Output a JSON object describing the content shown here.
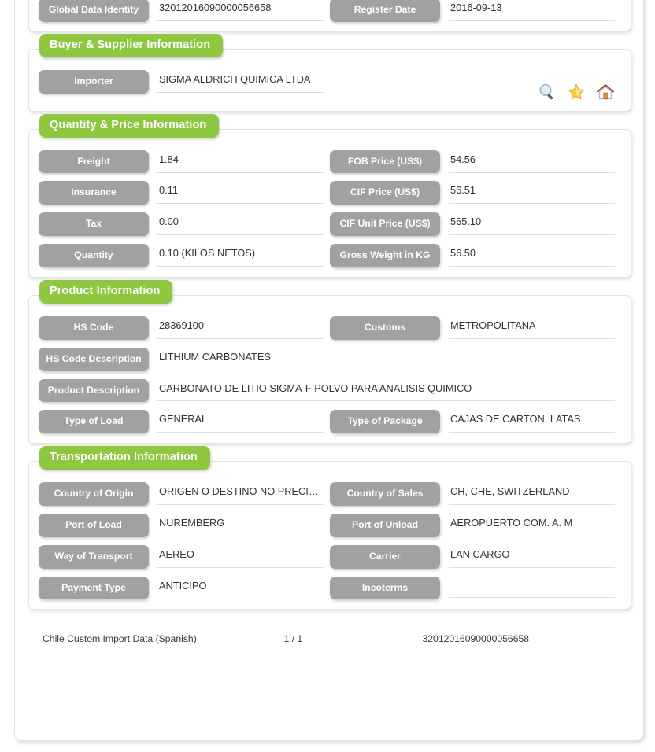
{
  "document": {
    "footer_source": "Chile Custom Import Data (Spanish)",
    "footer_page": "1 / 1",
    "footer_id": "32012016090000056658"
  },
  "colors": {
    "section_green": "#8fc740",
    "label_gray": "#a1a1a1",
    "value_text": "#333333",
    "underline": "#dedede"
  },
  "header_fields": {
    "global_data_identity_label": "Global Data Identity",
    "global_data_identity_value": "32012016090000056658",
    "register_date_label": "Register Date",
    "register_date_value": "2016-09-13"
  },
  "buyer_supplier": {
    "title": "Buyer & Supplier Information",
    "importer_label": "Importer",
    "importer_value": "SIGMA ALDRICH QUIMICA LTDA",
    "icons": [
      {
        "name": "search-icon",
        "title": "Search"
      },
      {
        "name": "star-icon",
        "title": "Favorite"
      },
      {
        "name": "home-icon",
        "title": "Home"
      }
    ]
  },
  "quantity_price": {
    "title": "Quantity & Price Information",
    "rows": [
      {
        "left_label": "Freight",
        "left_value": "1.84",
        "right_label": "FOB Price (US$)",
        "right_value": "54.56"
      },
      {
        "left_label": "Insurance",
        "left_value": "0.11",
        "right_label": "CIF Price (US$)",
        "right_value": "56.51"
      },
      {
        "left_label": "Tax",
        "left_value": "0.00",
        "right_label": "CIF Unit Price (US$)",
        "right_value": "565.10"
      },
      {
        "left_label": "Quantity",
        "left_value": "0.10 (KILOS NETOS)",
        "right_label": "Gross Weight in KG",
        "right_value": "56.50"
      }
    ]
  },
  "product": {
    "title": "Product Information",
    "hs_code_label": "HS Code",
    "hs_code_value": "28369100",
    "customs_label": "Customs",
    "customs_value": "METROPOLITANA",
    "hs_code_description_label": "HS Code Description",
    "hs_code_description_value": "LITHIUM CARBONATES",
    "product_description_label": "Product Description",
    "product_description_value": "CARBONATO DE LITIO SIGMA-F POLVO PARA ANALISIS QUIMICO",
    "type_of_load_label": "Type of Load",
    "type_of_load_value": "GENERAL",
    "type_of_package_label": "Type of Package",
    "type_of_package_value": "CAJAS DE CARTON, LATAS"
  },
  "transportation": {
    "title": "Transportation Information",
    "rows": [
      {
        "left_label": "Country of Origin",
        "left_value": "ORIGEN O DESTINO NO PRECISADO",
        "right_label": "Country of Sales",
        "right_value": "CH, CHE, SWITZERLAND"
      },
      {
        "left_label": "Port of Load",
        "left_value": "NUREMBERG",
        "right_label": "Port of Unload",
        "right_value": "AEROPUERTO COM. A. M"
      },
      {
        "left_label": "Way of Transport",
        "left_value": "AEREO",
        "right_label": "Carrier",
        "right_value": "LAN CARGO"
      },
      {
        "left_label": "Payment Type",
        "left_value": "ANTICIPO",
        "right_label": "Incoterms",
        "right_value": ""
      }
    ]
  }
}
